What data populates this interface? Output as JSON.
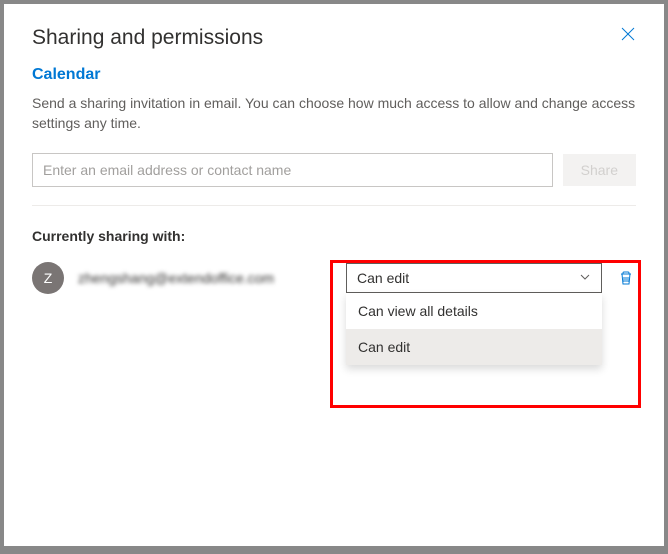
{
  "header": {
    "title": "Sharing and permissions"
  },
  "calendar": {
    "name": "Calendar",
    "description": "Send a sharing invitation in email. You can choose how much access to allow and change access settings any time."
  },
  "input": {
    "placeholder": "Enter an email address or contact name",
    "share_label": "Share"
  },
  "sharing": {
    "section_label": "Currently sharing with:",
    "entries": [
      {
        "avatar_initial": "Z",
        "name": "zhengshang@extendoffice.com",
        "permission_selected": "Can edit"
      }
    ]
  },
  "dropdown": {
    "options": [
      "Can view all details",
      "Can edit"
    ],
    "selected": "Can edit"
  }
}
